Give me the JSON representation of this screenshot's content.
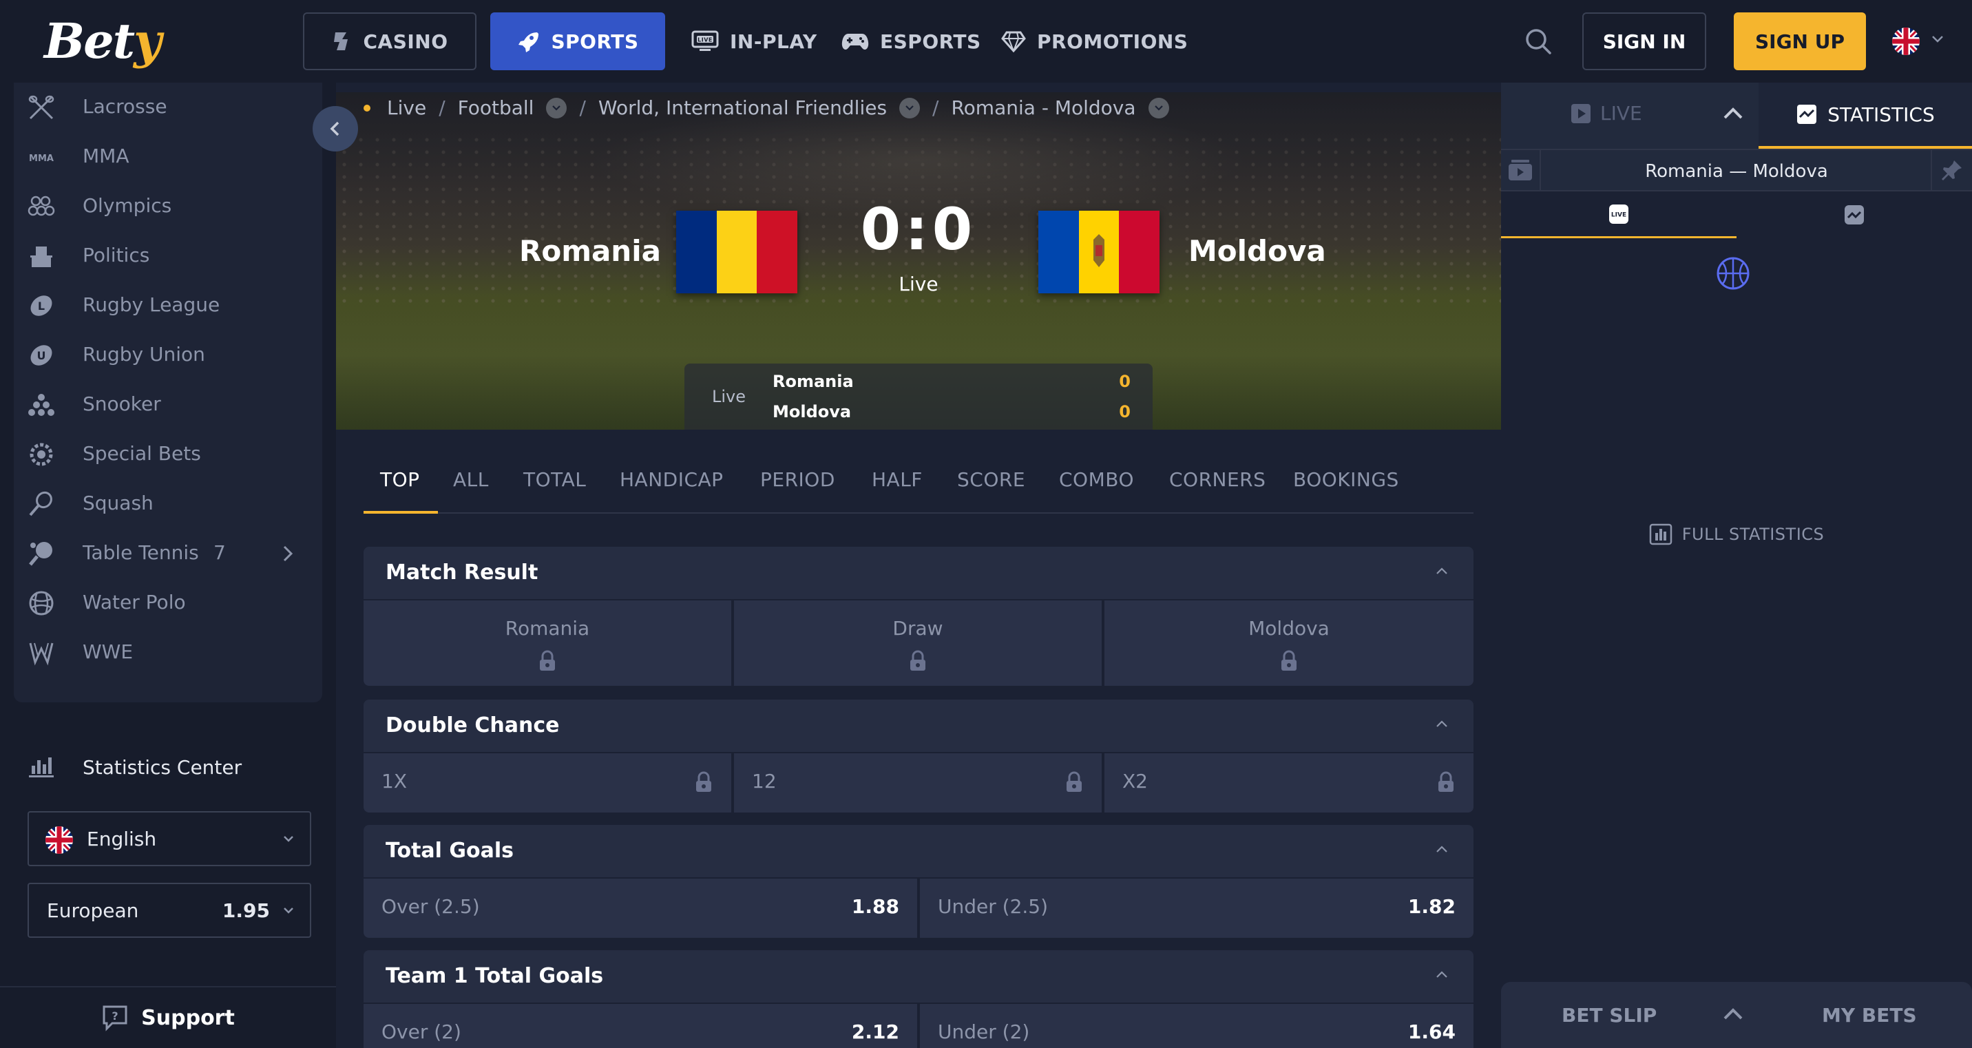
{
  "header": {
    "logo": {
      "main": "Bet",
      "accent": "y"
    },
    "nav": {
      "casino": "CASINO",
      "sports": "SPORTS",
      "inplay": "IN-PLAY",
      "esports": "ESPORTS",
      "promotions": "PROMOTIONS",
      "inplay_badge": "LIVE"
    },
    "sign_in": "SIGN IN",
    "sign_up": "SIGN UP"
  },
  "sidebar": {
    "items": [
      {
        "label": "Lacrosse",
        "icon": "lacrosse-icon"
      },
      {
        "label": "MMA",
        "icon": "mma-icon"
      },
      {
        "label": "Olympics",
        "icon": "olympics-icon"
      },
      {
        "label": "Politics",
        "icon": "politics-icon"
      },
      {
        "label": "Rugby League",
        "icon": "rugby-league-icon"
      },
      {
        "label": "Rugby Union",
        "icon": "rugby-union-icon"
      },
      {
        "label": "Snooker",
        "icon": "snooker-icon"
      },
      {
        "label": "Special Bets",
        "icon": "special-bets-icon"
      },
      {
        "label": "Squash",
        "icon": "squash-icon"
      },
      {
        "label": "Table Tennis",
        "icon": "table-tennis-icon",
        "count": "7"
      },
      {
        "label": "Water Polo",
        "icon": "water-polo-icon"
      },
      {
        "label": "WWE",
        "icon": "wwe-icon"
      }
    ],
    "mma_badge": "MMA",
    "statistics_center": "Statistics Center",
    "language": "English",
    "odds_format": {
      "label": "European",
      "value": "1.95"
    },
    "support": "Support"
  },
  "breadcrumb": {
    "live": "Live",
    "sport": "Football",
    "league": "World, International Friendlies",
    "match": "Romania - Moldova",
    "separator": "/"
  },
  "match": {
    "home": "Romania",
    "away": "Moldova",
    "home_score": "0",
    "away_score": "0",
    "score_sep": ":",
    "status": "Live",
    "scoreboard": {
      "status": "Live",
      "rows": [
        {
          "team": "Romania",
          "score": "0"
        },
        {
          "team": "Moldova",
          "score": "0"
        }
      ]
    }
  },
  "tabs": [
    "TOP",
    "ALL",
    "TOTAL",
    "HANDICAP",
    "PERIOD",
    "HALF",
    "SCORE",
    "COMBO",
    "CORNERS",
    "BOOKINGS"
  ],
  "markets": {
    "match_result": {
      "title": "Match Result",
      "outcomes": [
        "Romania",
        "Draw",
        "Moldova"
      ]
    },
    "double_chance": {
      "title": "Double Chance",
      "outcomes": [
        "1X",
        "12",
        "X2"
      ]
    },
    "total_goals": {
      "title": "Total Goals",
      "outcomes": [
        {
          "label": "Over (2.5)",
          "odds": "1.88"
        },
        {
          "label": "Under (2.5)",
          "odds": "1.82"
        }
      ]
    },
    "team1_total_goals": {
      "title": "Team 1 Total Goals",
      "outcomes": [
        {
          "label": "Over (2)",
          "odds": "2.12"
        },
        {
          "label": "Under (2)",
          "odds": "1.64"
        }
      ]
    }
  },
  "right_panel": {
    "live_tab": "LIVE",
    "statistics_tab": "STATISTICS",
    "match_title": "Romania — Moldova",
    "live_badge": "LIVE",
    "full_statistics": "FULL STATISTICS",
    "bet_slip": "BET SLIP",
    "my_bets": "MY BETS"
  },
  "colors": {
    "accent": "#f5b52e",
    "sports_active": "#3355c7",
    "background": "#171c2b",
    "panel": "#1b2133",
    "romania_flag": [
      "#002b7f",
      "#fcd116",
      "#ce1126"
    ],
    "moldova_flag": [
      "#0046ae",
      "#ffd200",
      "#cc092f"
    ]
  }
}
